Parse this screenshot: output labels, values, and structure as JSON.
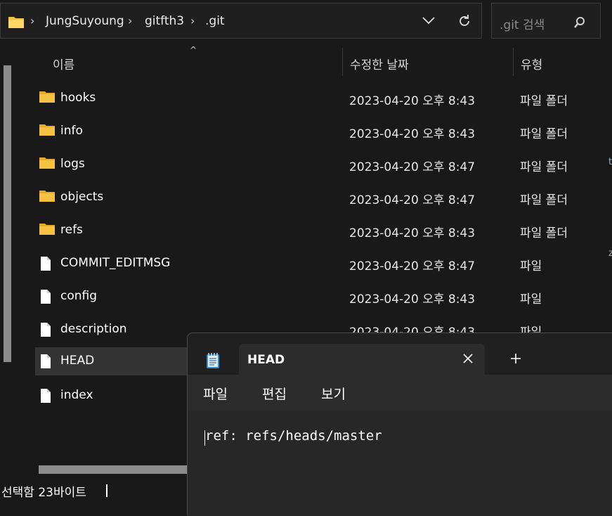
{
  "address_bar": {
    "path": [
      "JungSuyoung",
      "gitfth3",
      ".git"
    ]
  },
  "search": {
    "placeholder": ".git 검색"
  },
  "columns": {
    "name": "이름",
    "date": "수정한 날짜",
    "type": "유형"
  },
  "files": [
    {
      "name": "hooks",
      "date": "2023-04-20 오후 8:43",
      "type": "파일 폴더",
      "kind": "folder"
    },
    {
      "name": "info",
      "date": "2023-04-20 오후 8:43",
      "type": "파일 폴더",
      "kind": "folder"
    },
    {
      "name": "logs",
      "date": "2023-04-20 오후 8:47",
      "type": "파일 폴더",
      "kind": "folder"
    },
    {
      "name": "objects",
      "date": "2023-04-20 오후 8:47",
      "type": "파일 폴더",
      "kind": "folder"
    },
    {
      "name": "refs",
      "date": "2023-04-20 오후 8:43",
      "type": "파일 폴더",
      "kind": "folder"
    },
    {
      "name": "COMMIT_EDITMSG",
      "date": "2023-04-20 오후 8:47",
      "type": "파일",
      "kind": "file"
    },
    {
      "name": "config",
      "date": "2023-04-20 오후 8:43",
      "type": "파일",
      "kind": "file"
    },
    {
      "name": "description",
      "date": "2023-04-20 오후 8:43",
      "type": "파일",
      "kind": "file"
    },
    {
      "name": "HEAD",
      "date": "",
      "type": "",
      "kind": "file",
      "selected": true
    },
    {
      "name": "index",
      "date": "",
      "type": "",
      "kind": "file"
    }
  ],
  "status_bar": {
    "selection": "선택함 23바이트"
  },
  "notepad": {
    "tab_title": "HEAD",
    "menu": [
      "파일",
      "편집",
      "보기"
    ],
    "content": "ref: refs/heads/master"
  },
  "colors": {
    "background": "#191919",
    "folder": "#f5c242",
    "selected_row": "#333333"
  }
}
